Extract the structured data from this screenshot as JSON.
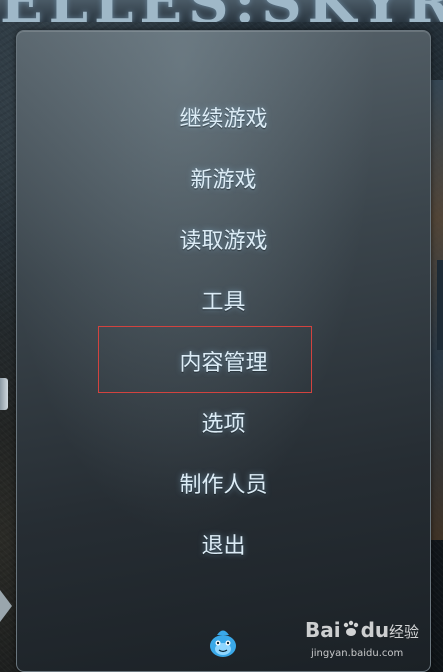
{
  "game": {
    "logo_text": "ELLES:SKYRIM"
  },
  "menu": {
    "items": [
      {
        "label": "继续游戏"
      },
      {
        "label": "新游戏"
      },
      {
        "label": "读取游戏"
      },
      {
        "label": "工具"
      },
      {
        "label": "内容管理"
      },
      {
        "label": "选项"
      },
      {
        "label": "制作人员"
      },
      {
        "label": "退出"
      }
    ],
    "highlighted_item": "内容管理",
    "highlight_color": "#d2433f",
    "text_color": "#dcecf6"
  },
  "mascot": {
    "icon": "fish-mascot-icon",
    "color": "#3aa8e8"
  },
  "watermark": {
    "logo": "Bai",
    "logo_suffix": "du",
    "name": "经验",
    "url": "jingyan.baidu.com"
  }
}
